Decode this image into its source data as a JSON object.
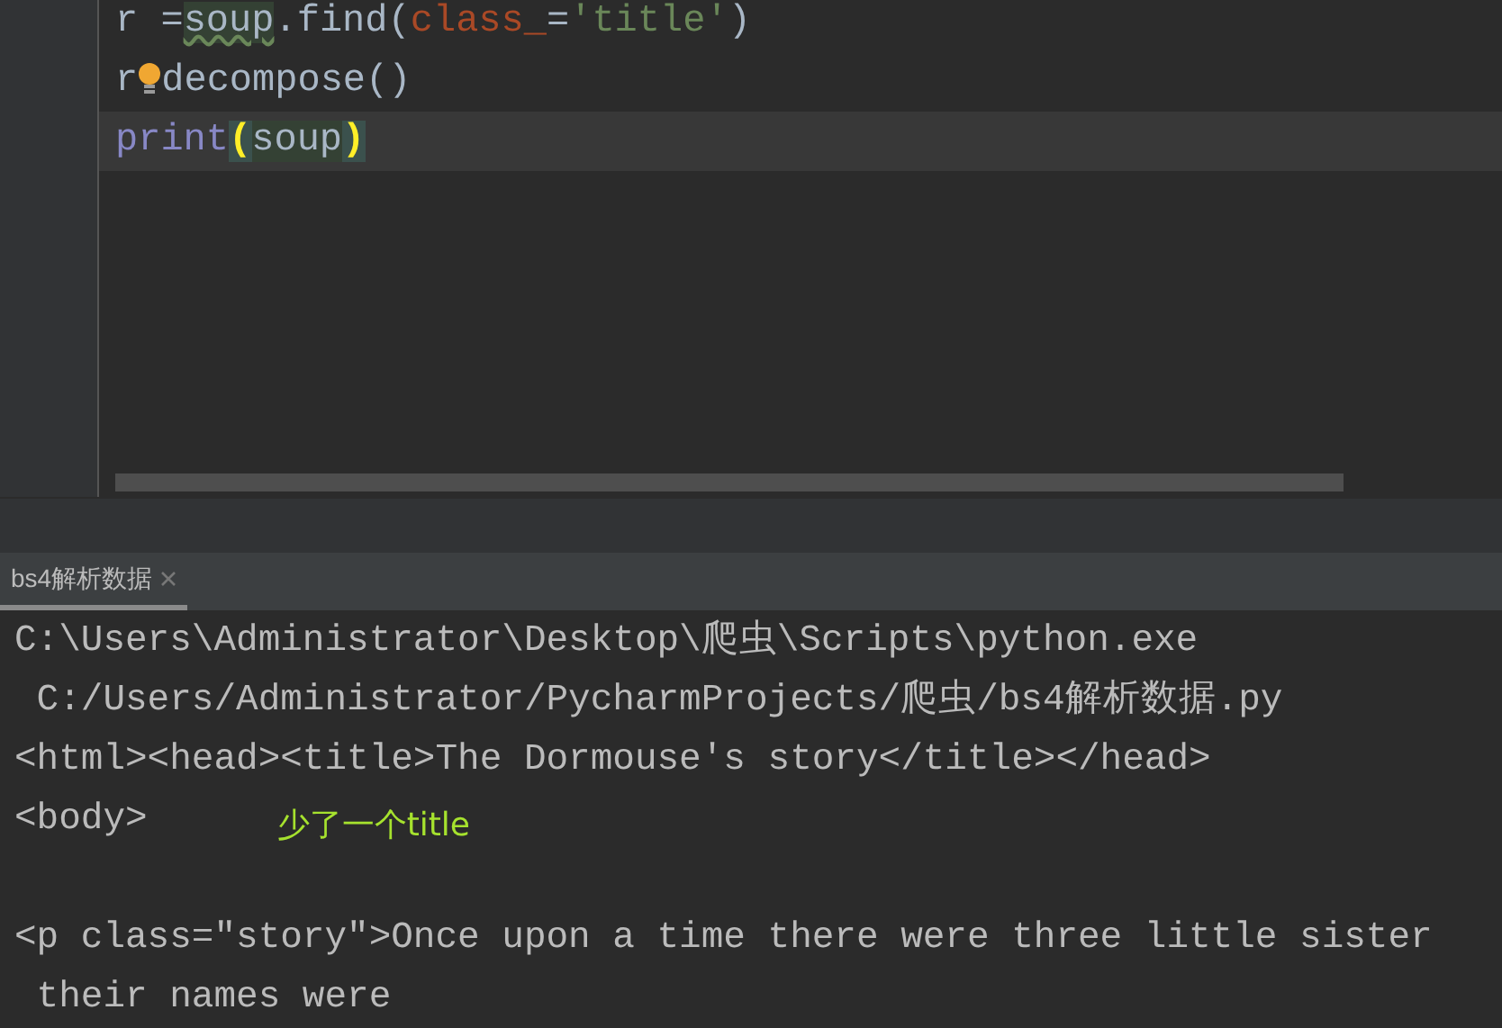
{
  "editor": {
    "lines": [
      {
        "current": false,
        "tokens": [
          {
            "kind": "plain",
            "text": "r ="
          },
          {
            "kind": "ref",
            "text": "soup"
          },
          {
            "kind": "plain",
            "text": ".find("
          },
          {
            "kind": "kwarg",
            "text": "class_"
          },
          {
            "kind": "plain",
            "text": "="
          },
          {
            "kind": "string",
            "text": "'title'"
          },
          {
            "kind": "plain",
            "text": ")"
          }
        ]
      },
      {
        "current": false,
        "tokens": [
          {
            "kind": "plain",
            "text": "r"
          },
          {
            "kind": "bulb"
          },
          {
            "kind": "plain",
            "text": "decompose()"
          }
        ]
      },
      {
        "current": true,
        "tokens": [
          {
            "kind": "builtin",
            "text": "print"
          },
          {
            "kind": "brace",
            "text": "("
          },
          {
            "kind": "usage",
            "text": "soup"
          },
          {
            "kind": "brace",
            "text": ")"
          }
        ]
      }
    ]
  },
  "run_tabs": [
    {
      "label": "bs4解析数据",
      "selected": true
    }
  ],
  "console": {
    "lines": [
      {
        "kind": "output",
        "text": "C:\\Users\\Administrator\\Desktop\\爬虫\\Scripts\\python.exe"
      },
      {
        "kind": "output",
        "text": " C:/Users/Administrator/PycharmProjects/爬虫/bs4解析数据.py"
      },
      {
        "kind": "output",
        "text": "<html><head><title>The Dormouse's story</title></head>"
      },
      {
        "kind": "output",
        "text": "<body>",
        "annotation": "少了一个title"
      },
      {
        "kind": "blank"
      },
      {
        "kind": "output",
        "text": "<p class=\"story\">Once upon a time there were three little sister"
      },
      {
        "kind": "output",
        "text": " their names were"
      }
    ]
  }
}
